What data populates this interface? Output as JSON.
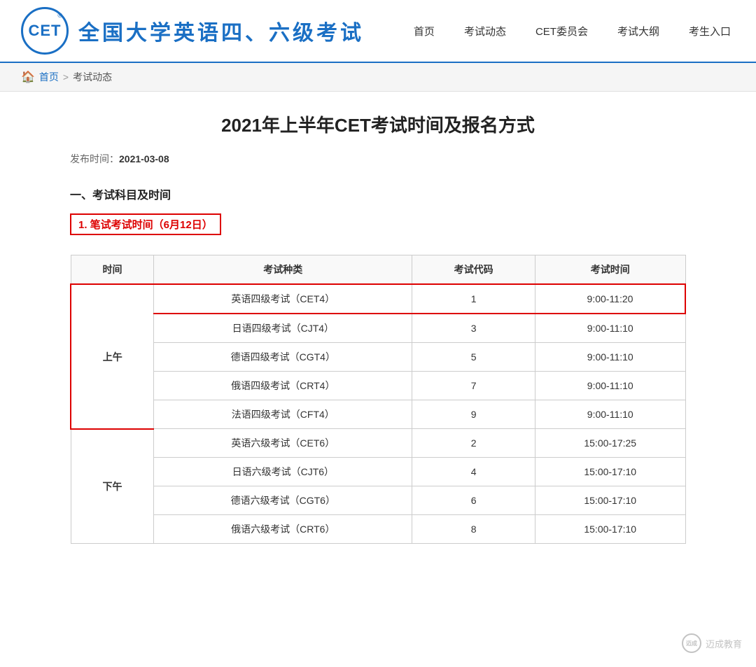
{
  "header": {
    "logo_text": "CET",
    "logo_reg": "®",
    "site_title": "全国大学英语四、六级考试",
    "nav_items": [
      "首页",
      "考试动态",
      "CET委员会",
      "考试大纲",
      "考生入口"
    ]
  },
  "breadcrumb": {
    "home_label": "首页",
    "separator": ">",
    "current": "考试动态"
  },
  "article": {
    "title": "2021年上半年CET考试时间及报名方式",
    "publish_label": "发布时间：",
    "publish_date": "2021-03-08",
    "section1_title": "一、考试科目及时间",
    "subsection1_label": "1. 笔试考试时间（6月12日）"
  },
  "table": {
    "headers": [
      "时间",
      "考试种类",
      "考试代码",
      "考试时间"
    ],
    "rows": [
      {
        "period": "上午",
        "period_rowspan": 5,
        "type": "英语四级考试（CET4）",
        "code": "1",
        "time": "9:00-11:20",
        "highlight": true
      },
      {
        "period": "",
        "type": "日语四级考试（CJT4）",
        "code": "3",
        "time": "9:00-11:10",
        "highlight": false
      },
      {
        "period": "",
        "type": "德语四级考试（CGT4）",
        "code": "5",
        "time": "9:00-11:10",
        "highlight": false
      },
      {
        "period": "",
        "type": "俄语四级考试（CRT4）",
        "code": "7",
        "time": "9:00-11:10",
        "highlight": false
      },
      {
        "period": "",
        "type": "法语四级考试（CFT4）",
        "code": "9",
        "time": "9:00-11:10",
        "highlight": false
      },
      {
        "period": "下午",
        "period_rowspan": 4,
        "type": "英语六级考试（CET6）",
        "code": "2",
        "time": "15:00-17:25",
        "highlight": false
      },
      {
        "period": "",
        "type": "日语六级考试（CJT6）",
        "code": "4",
        "time": "15:00-17:10",
        "highlight": false
      },
      {
        "period": "",
        "type": "德语六级考试（CGT6）",
        "code": "6",
        "time": "15:00-17:10",
        "highlight": false
      },
      {
        "period": "",
        "type": "俄语六级考试（CRT6）",
        "code": "8",
        "time": "15:00-17:10",
        "highlight": false
      }
    ]
  },
  "watermark": {
    "logo": "迈成",
    "text": "迈成教育"
  }
}
